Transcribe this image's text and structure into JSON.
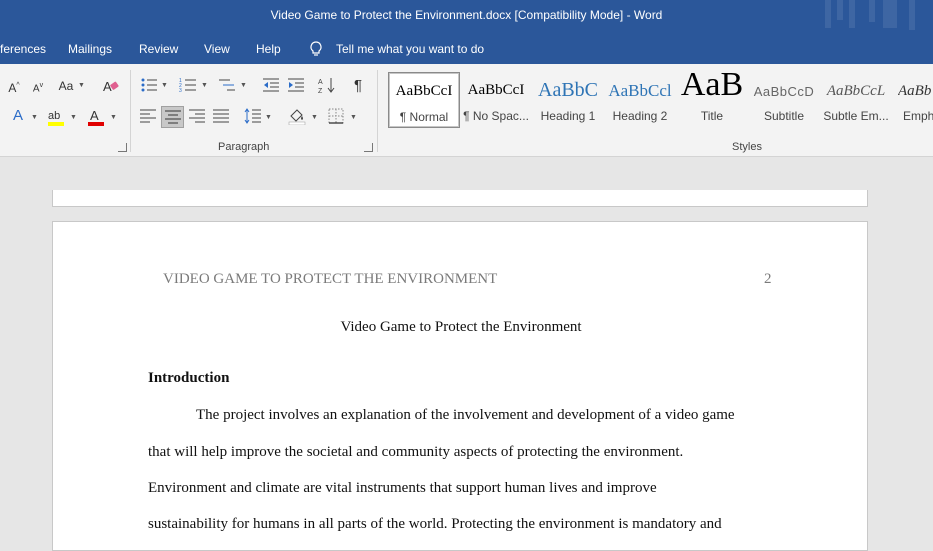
{
  "window": {
    "title": "Video Game to Protect the Environment.docx [Compatibility Mode]  -  Word"
  },
  "menu": {
    "references": "ferences",
    "mailings": "Mailings",
    "review": "Review",
    "view": "View",
    "help": "Help",
    "tell_me": "Tell me what you want to do"
  },
  "ribbon": {
    "font": {
      "grow": "A",
      "shrink": "A",
      "change_case": "Aa",
      "text_effects": "A",
      "font_color": "A",
      "highlight_color": "#ffff00",
      "font_color_value": "#e00000"
    },
    "paragraph_label": "Paragraph",
    "styles_label": "Styles",
    "styles": [
      {
        "sample": "AaBbCcI",
        "name": "¶ Normal"
      },
      {
        "sample": "AaBbCcI",
        "name": "¶ No Spac..."
      },
      {
        "sample": "AaBbC",
        "name": "Heading 1"
      },
      {
        "sample": "AaBbCcl",
        "name": "Heading 2"
      },
      {
        "sample": "AaB",
        "name": "Title"
      },
      {
        "sample": "AaBbCcD",
        "name": "Subtitle"
      },
      {
        "sample": "AaBbCcL",
        "name": "Subtle Em..."
      },
      {
        "sample": "AaBb",
        "name": "Emph"
      }
    ]
  },
  "document": {
    "running_head": "VIDEO GAME TO PROTECT THE ENVIRONMENT",
    "page_number": "2",
    "title": "Video Game to Protect the Environment",
    "heading": "Introduction",
    "lines": [
      "The project involves an explanation of the involvement and development of a video game",
      "that will help improve the societal and community aspects of protecting the environment.",
      "Environment and climate are vital instruments that support human lives and improve",
      "sustainability for humans in all parts of the world. Protecting the environment is mandatory and"
    ]
  },
  "colors": {
    "title_bar": "#2b579a",
    "ribbon": "#f3f3f3",
    "workspace": "#e6e6e6"
  }
}
